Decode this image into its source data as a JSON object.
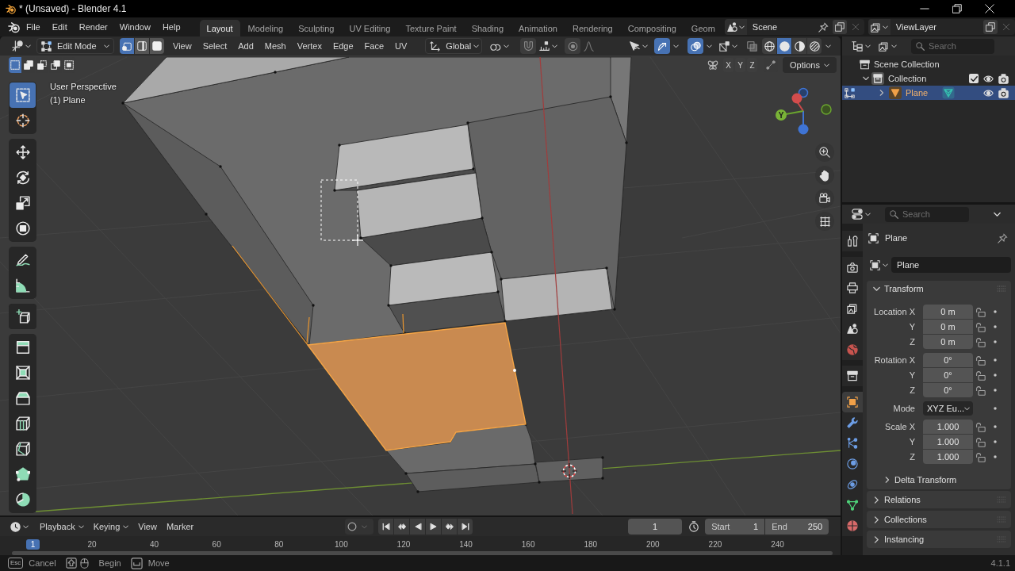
{
  "title_bar": {
    "title": "* (Unsaved) - Blender 4.1"
  },
  "menu_bar": [
    "File",
    "Edit",
    "Render",
    "Window",
    "Help"
  ],
  "workspace_tabs": [
    {
      "label": "Layout",
      "selected": true
    },
    {
      "label": "Modeling",
      "selected": false
    },
    {
      "label": "Sculpting",
      "selected": false
    },
    {
      "label": "UV Editing",
      "selected": false
    },
    {
      "label": "Texture Paint",
      "selected": false
    },
    {
      "label": "Shading",
      "selected": false
    },
    {
      "label": "Animation",
      "selected": false
    },
    {
      "label": "Rendering",
      "selected": false
    },
    {
      "label": "Compositing",
      "selected": false
    },
    {
      "label": "Geom",
      "selected": false
    }
  ],
  "scene_selector": {
    "value": "Scene"
  },
  "view_layer_selector": {
    "value": "ViewLayer"
  },
  "viewport_header": {
    "mode": "Edit Mode",
    "select_modes": [
      {
        "kind": "vertex",
        "selected": true
      },
      {
        "kind": "edge",
        "selected": false
      },
      {
        "kind": "face",
        "selected": false
      }
    ],
    "menus": [
      "View",
      "Select",
      "Add",
      "Mesh",
      "Vertex",
      "Edge",
      "Face",
      "UV"
    ],
    "orientation": "Global",
    "toggles": [
      {
        "kind": "snap",
        "on": false
      },
      {
        "kind": "proportional",
        "on": false
      },
      {
        "kind": "gizmos",
        "on": true
      },
      {
        "kind": "overlays",
        "on": true
      },
      {
        "kind": "xray",
        "on": false
      }
    ],
    "shading": [
      {
        "kind": "wireframe",
        "selected": false
      },
      {
        "kind": "solid",
        "selected": true
      },
      {
        "kind": "material",
        "selected": false
      },
      {
        "kind": "rendered",
        "selected": false
      }
    ]
  },
  "tool_settings": {
    "box_modes": [
      {
        "kind": "set",
        "selected": true
      },
      {
        "kind": "extend",
        "selected": false
      },
      {
        "kind": "subtract",
        "selected": false
      },
      {
        "kind": "invert",
        "selected": false
      },
      {
        "kind": "intersect",
        "selected": false
      }
    ],
    "mirror_axes": [
      {
        "label": "X",
        "on": false
      },
      {
        "label": "Y",
        "on": false
      },
      {
        "label": "Z",
        "on": false
      }
    ],
    "options": "Options"
  },
  "viewport": {
    "view_name": "User Perspective",
    "object_info": "(1) Plane",
    "gizmo_label": "Y"
  },
  "toolbar": [
    {
      "kind": "select_box",
      "selected": true
    },
    {
      "kind": "cursor",
      "selected": false
    },
    {
      "kind": "move",
      "selected": false
    },
    {
      "kind": "rotate",
      "selected": false
    },
    {
      "kind": "scale",
      "selected": false
    },
    {
      "kind": "transform",
      "selected": false
    },
    {
      "kind": "annotate",
      "selected": false
    },
    {
      "kind": "measure",
      "selected": false
    },
    {
      "kind": "add_cube",
      "selected": false
    },
    {
      "kind": "extrude",
      "selected": false
    },
    {
      "kind": "inset",
      "selected": false
    },
    {
      "kind": "bevel",
      "selected": false
    },
    {
      "kind": "loop_cut",
      "selected": false
    },
    {
      "kind": "knife",
      "selected": false
    },
    {
      "kind": "poly_build",
      "selected": false
    },
    {
      "kind": "spin",
      "selected": false
    }
  ],
  "outliner": {
    "search_placeholder": "Search",
    "tree": [
      {
        "kind": "scene_collection",
        "label": "Scene Collection",
        "children": [
          {
            "kind": "collection",
            "label": "Collection",
            "expanded": true,
            "checked": true,
            "children": [
              {
                "kind": "mesh_object",
                "label": "Plane",
                "expanded": false,
                "selected": true
              }
            ]
          }
        ]
      }
    ]
  },
  "properties": {
    "search_placeholder": "Search",
    "tabs": [
      {
        "kind": "tool",
        "selected": false
      },
      {
        "kind": "render",
        "selected": false
      },
      {
        "kind": "output",
        "selected": false
      },
      {
        "kind": "view_layer",
        "selected": false
      },
      {
        "kind": "scene",
        "selected": false
      },
      {
        "kind": "world",
        "selected": false
      },
      {
        "kind": "collection",
        "selected": false
      },
      {
        "kind": "object",
        "selected": true
      },
      {
        "kind": "modifiers",
        "selected": false
      },
      {
        "kind": "particles",
        "selected": false
      },
      {
        "kind": "physics",
        "selected": false
      },
      {
        "kind": "constraints",
        "selected": false
      },
      {
        "kind": "data",
        "selected": false
      },
      {
        "kind": "material",
        "selected": false
      }
    ],
    "object_name": "Plane",
    "datablock_name": "Plane",
    "transform": {
      "title": "Transform",
      "expanded": true,
      "groups": [
        {
          "rows": [
            {
              "kind": "field",
              "label": "Location X",
              "value": "0 m",
              "locked": false
            },
            {
              "kind": "field",
              "label": "Y",
              "value": "0 m",
              "locked": false
            },
            {
              "kind": "field",
              "label": "Z",
              "value": "0 m",
              "locked": false
            }
          ]
        },
        {
          "rows": [
            {
              "kind": "field",
              "label": "Rotation X",
              "value": "0°",
              "locked": false
            },
            {
              "kind": "field",
              "label": "Y",
              "value": "0°",
              "locked": false
            },
            {
              "kind": "field",
              "label": "Z",
              "value": "0°",
              "locked": false
            }
          ]
        },
        {
          "rows": [
            {
              "kind": "dropdown",
              "label": "Mode",
              "value": "XYZ Eu..."
            }
          ]
        },
        {
          "rows": [
            {
              "kind": "field",
              "label": "Scale X",
              "value": "1.000",
              "locked": false
            },
            {
              "kind": "field",
              "label": "Y",
              "value": "1.000",
              "locked": false
            },
            {
              "kind": "field",
              "label": "Z",
              "value": "1.000",
              "locked": false
            }
          ]
        }
      ],
      "subpanels": [
        {
          "title": "Delta Transform",
          "expanded": false
        }
      ]
    },
    "panels": [
      {
        "title": "Relations",
        "expanded": false
      },
      {
        "title": "Collections",
        "expanded": false
      },
      {
        "title": "Instancing",
        "expanded": false
      }
    ]
  },
  "timeline": {
    "menus": [
      {
        "label": "Playback",
        "dropdown": true
      },
      {
        "label": "Keying",
        "dropdown": true
      },
      {
        "label": "View",
        "dropdown": false
      },
      {
        "label": "Marker",
        "dropdown": false
      }
    ],
    "auto_keying": false,
    "current_frame": "1",
    "start_label": "Start",
    "start": "1",
    "end_label": "End",
    "end": "250",
    "ruler_current": "1",
    "ruler_ticks": [
      "20",
      "40",
      "60",
      "80",
      "100",
      "120",
      "140",
      "160",
      "180",
      "200",
      "220",
      "240"
    ]
  },
  "status_bar": {
    "hints": [
      {
        "kind": "esc",
        "key": "Esc",
        "label": "Cancel"
      },
      {
        "kind": "shift_mouse",
        "label": "Begin"
      },
      {
        "kind": "space",
        "label": "Move"
      }
    ],
    "version": "4.1.1"
  }
}
